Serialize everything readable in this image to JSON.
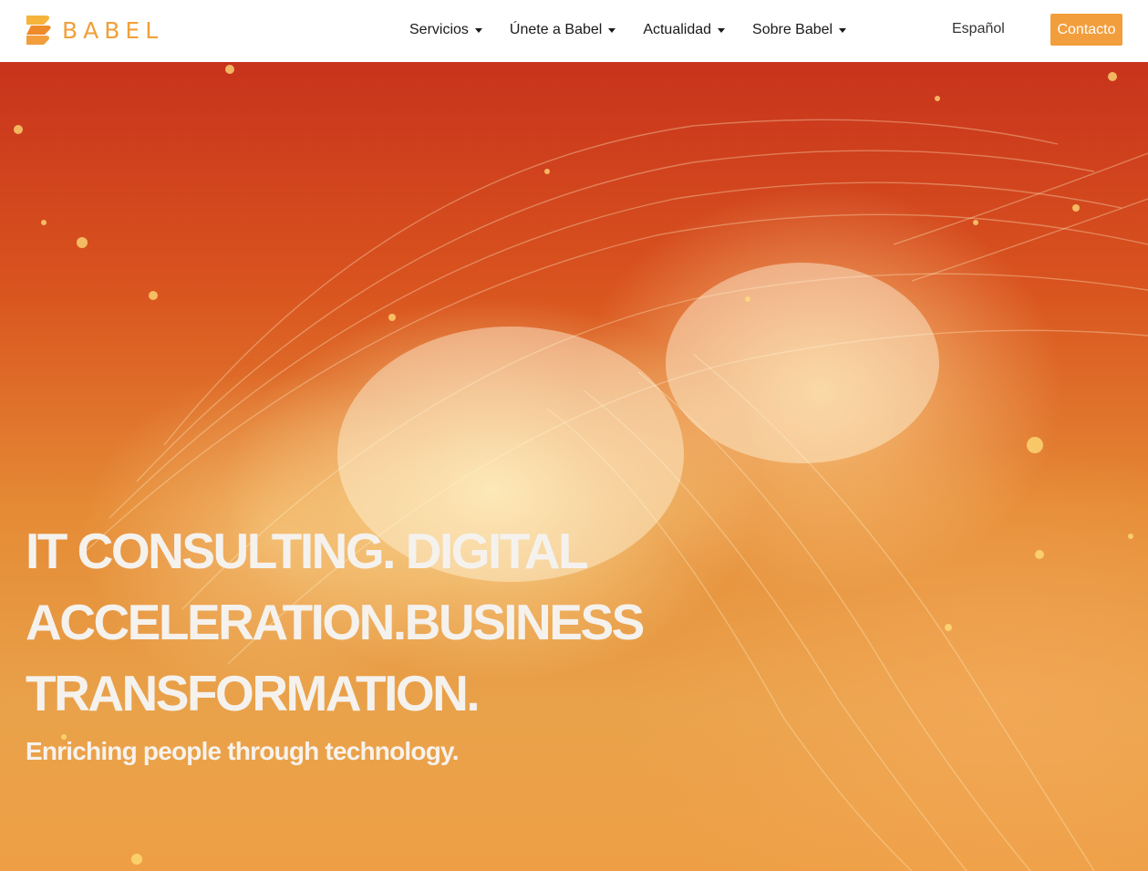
{
  "header": {
    "logo_text": "BABEL",
    "brand_color": "#f29e3c",
    "nav": [
      {
        "label": "Servicios",
        "icon": "caret-down-icon"
      },
      {
        "label": "Únete a Babel",
        "icon": "caret-down-icon"
      },
      {
        "label": "Actualidad",
        "icon": "caret-down-icon"
      },
      {
        "label": "Sobre Babel",
        "icon": "caret-down-icon"
      }
    ],
    "language": "Español",
    "contact_label": "Contacto"
  },
  "hero": {
    "headline": "IT CONSULTING. DIGITAL ACCELERATION.BUSINESS TRANSFORMATION.",
    "subheadline": "Enriching people through technology."
  }
}
